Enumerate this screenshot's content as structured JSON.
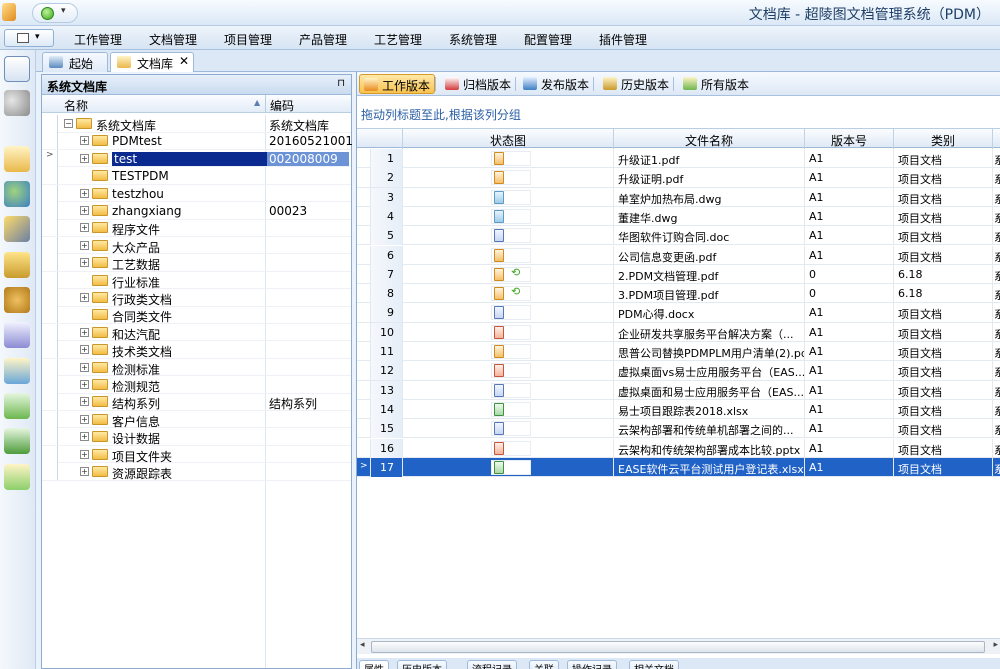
{
  "window": {
    "title": "文档库 - 超陵图文档管理系统（PDM）"
  },
  "menu": {
    "items": [
      "工作管理",
      "文档管理",
      "项目管理",
      "产品管理",
      "工艺管理",
      "系统管理",
      "配置管理",
      "插件管理"
    ]
  },
  "doc_tabs": [
    {
      "label": "起始页"
    },
    {
      "label": "文档库",
      "close": "✕"
    }
  ],
  "left_panel": {
    "title": "系统文档库",
    "pin": "⊓",
    "columns": {
      "name": "名称",
      "code": "编码"
    },
    "rows": [
      {
        "name": "系统文档库",
        "code": "系统文档库",
        "level": 0,
        "expander": "−"
      },
      {
        "name": "PDMtest",
        "code": "20160521001",
        "level": 1,
        "expander": "+"
      },
      {
        "name": "test",
        "code": "002008009",
        "level": 1,
        "expander": "+",
        "selected": true,
        "indicator": ">"
      },
      {
        "name": "TESTPDM",
        "code": "",
        "level": 1,
        "expander": ""
      },
      {
        "name": "testzhou",
        "code": "",
        "level": 1,
        "expander": "+"
      },
      {
        "name": "zhangxiang",
        "code": "00023",
        "level": 1,
        "expander": "+"
      },
      {
        "name": "程序文件",
        "code": "",
        "level": 1,
        "expander": "+"
      },
      {
        "name": "大众产品",
        "code": "",
        "level": 1,
        "expander": "+"
      },
      {
        "name": "工艺数据",
        "code": "",
        "level": 1,
        "expander": "+"
      },
      {
        "name": "行业标准",
        "code": "",
        "level": 1,
        "expander": ""
      },
      {
        "name": "行政类文档",
        "code": "",
        "level": 1,
        "expander": "+"
      },
      {
        "name": "合同类文件",
        "code": "",
        "level": 1,
        "expander": ""
      },
      {
        "name": "和达汽配",
        "code": "",
        "level": 1,
        "expander": "+"
      },
      {
        "name": "技术类文档",
        "code": "",
        "level": 1,
        "expander": "+"
      },
      {
        "name": "检测标准",
        "code": "",
        "level": 1,
        "expander": "+"
      },
      {
        "name": "检测规范",
        "code": "",
        "level": 1,
        "expander": "+"
      },
      {
        "name": "结构系列",
        "code": "结构系列",
        "level": 1,
        "expander": "+"
      },
      {
        "name": "客户信息",
        "code": "",
        "level": 1,
        "expander": "+"
      },
      {
        "name": "设计数据",
        "code": "",
        "level": 1,
        "expander": "+"
      },
      {
        "name": "项目文件夹",
        "code": "",
        "level": 1,
        "expander": "+"
      },
      {
        "name": "资源跟踪表",
        "code": "",
        "level": 1,
        "expander": "+"
      }
    ]
  },
  "toolbar": {
    "buttons": [
      "工作版本",
      "归档版本",
      "发布版本",
      "历史版本",
      "所有版本"
    ]
  },
  "grid": {
    "group_hint": "拖动列标题至此,根据该列分组",
    "columns": [
      "状态图",
      "文件名称",
      "版本号",
      "类别"
    ],
    "rows": [
      {
        "n": "1",
        "file": "升级证1.pdf",
        "ver": "A1",
        "cat": "项目文档",
        "icon": "pdf",
        "extra": "系"
      },
      {
        "n": "2",
        "file": "升级证明.pdf",
        "ver": "A1",
        "cat": "项目文档",
        "icon": "pdf",
        "extra": "系"
      },
      {
        "n": "3",
        "file": "单室炉加热布局.dwg",
        "ver": "A1",
        "cat": "项目文档",
        "icon": "dwg",
        "extra": "系"
      },
      {
        "n": "4",
        "file": "董建华.dwg",
        "ver": "A1",
        "cat": "项目文档",
        "icon": "dwg",
        "extra": "系"
      },
      {
        "n": "5",
        "file": "华图软件订购合同.doc",
        "ver": "A1",
        "cat": "项目文档",
        "icon": "doc",
        "extra": "系"
      },
      {
        "n": "6",
        "file": "公司信息变更函.pdf",
        "ver": "A1",
        "cat": "项目文档",
        "icon": "pdf",
        "extra": "系"
      },
      {
        "n": "7",
        "file": "2.PDM文档管理.pdf",
        "ver": "0",
        "cat": "6.18",
        "icon": "pdf",
        "arrow": "⟲",
        "extra": "系"
      },
      {
        "n": "8",
        "file": "3.PDM项目管理.pdf",
        "ver": "0",
        "cat": "6.18",
        "icon": "pdf",
        "arrow": "⟲",
        "extra": "系"
      },
      {
        "n": "9",
        "file": "PDM心得.docx",
        "ver": "A1",
        "cat": "项目文档",
        "icon": "doc",
        "extra": "系"
      },
      {
        "n": "10",
        "file": "企业研发共享服务平台解决方案（...",
        "ver": "A1",
        "cat": "项目文档",
        "icon": "ppt",
        "extra": "系"
      },
      {
        "n": "11",
        "file": "思普公司替换PDMPLM用户清单(2).pdf",
        "ver": "A1",
        "cat": "项目文档",
        "icon": "pdf",
        "extra": "系"
      },
      {
        "n": "12",
        "file": "虚拟桌面vs易士应用服务平台（EAS...",
        "ver": "A1",
        "cat": "项目文档",
        "icon": "ppt",
        "extra": "系"
      },
      {
        "n": "13",
        "file": "虚拟桌面和易士应用服务平台（EAS...",
        "ver": "A1",
        "cat": "项目文档",
        "icon": "doc",
        "extra": "系"
      },
      {
        "n": "14",
        "file": "易士项目跟踪表2018.xlsx",
        "ver": "A1",
        "cat": "项目文档",
        "icon": "xls",
        "extra": "系"
      },
      {
        "n": "15",
        "file": "云架构部署和传统单机部署之间的...",
        "ver": "A1",
        "cat": "项目文档",
        "icon": "doc",
        "extra": "系"
      },
      {
        "n": "16",
        "file": "云架构和传统架构部署成本比较.pptx",
        "ver": "A1",
        "cat": "项目文档",
        "icon": "ppt",
        "extra": "系"
      },
      {
        "n": "17",
        "file": "EASE软件云平台测试用户登记表.xlsx",
        "ver": "A1",
        "cat": "项目文档",
        "icon": "xls",
        "extra": "系",
        "selected": true,
        "indicator": ">"
      }
    ]
  },
  "bottom_tabs": [
    "属性",
    "历史版本",
    "流程记录",
    "关联",
    "操作记录",
    "相关文档"
  ],
  "scroll": {
    "left": "◂",
    "right": "▸"
  }
}
